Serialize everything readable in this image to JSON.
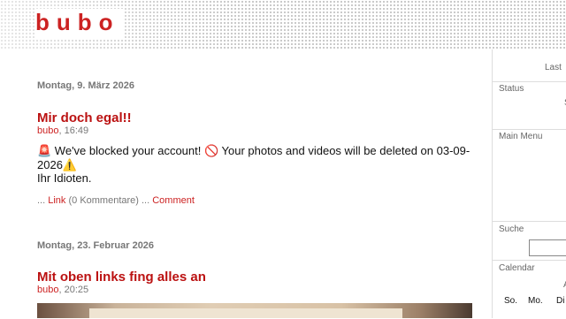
{
  "header": {
    "logo": "bubo"
  },
  "posts": [
    {
      "date": "Montag, 9. März 2026",
      "title": "Mir doch egal!!",
      "author": "bubo",
      "time": ", 16:49",
      "body_line1": "🚨 We've blocked your account! 🚫 Your photos and videos will be deleted on 03-09-",
      "body_line2": "2026⚠️",
      "body_line3": "Ihr Idioten.",
      "footer_prefix": "... ",
      "link_label": "Link",
      "comments_count": " (0 Kommentare) ... ",
      "comment_label": "Comment"
    },
    {
      "date": "Montag, 23. Februar 2026",
      "title": "Mit oben links fing alles an",
      "author": "bubo",
      "time": ", 20:25"
    }
  ],
  "sidebar": {
    "last": "Last",
    "status": "Status",
    "status_partial": "S",
    "main_menu": "Main Menu",
    "search": "Suche",
    "calendar": "Calendar",
    "calendar_partial": "A",
    "days": [
      "So.",
      "Mo.",
      "Di"
    ]
  }
}
